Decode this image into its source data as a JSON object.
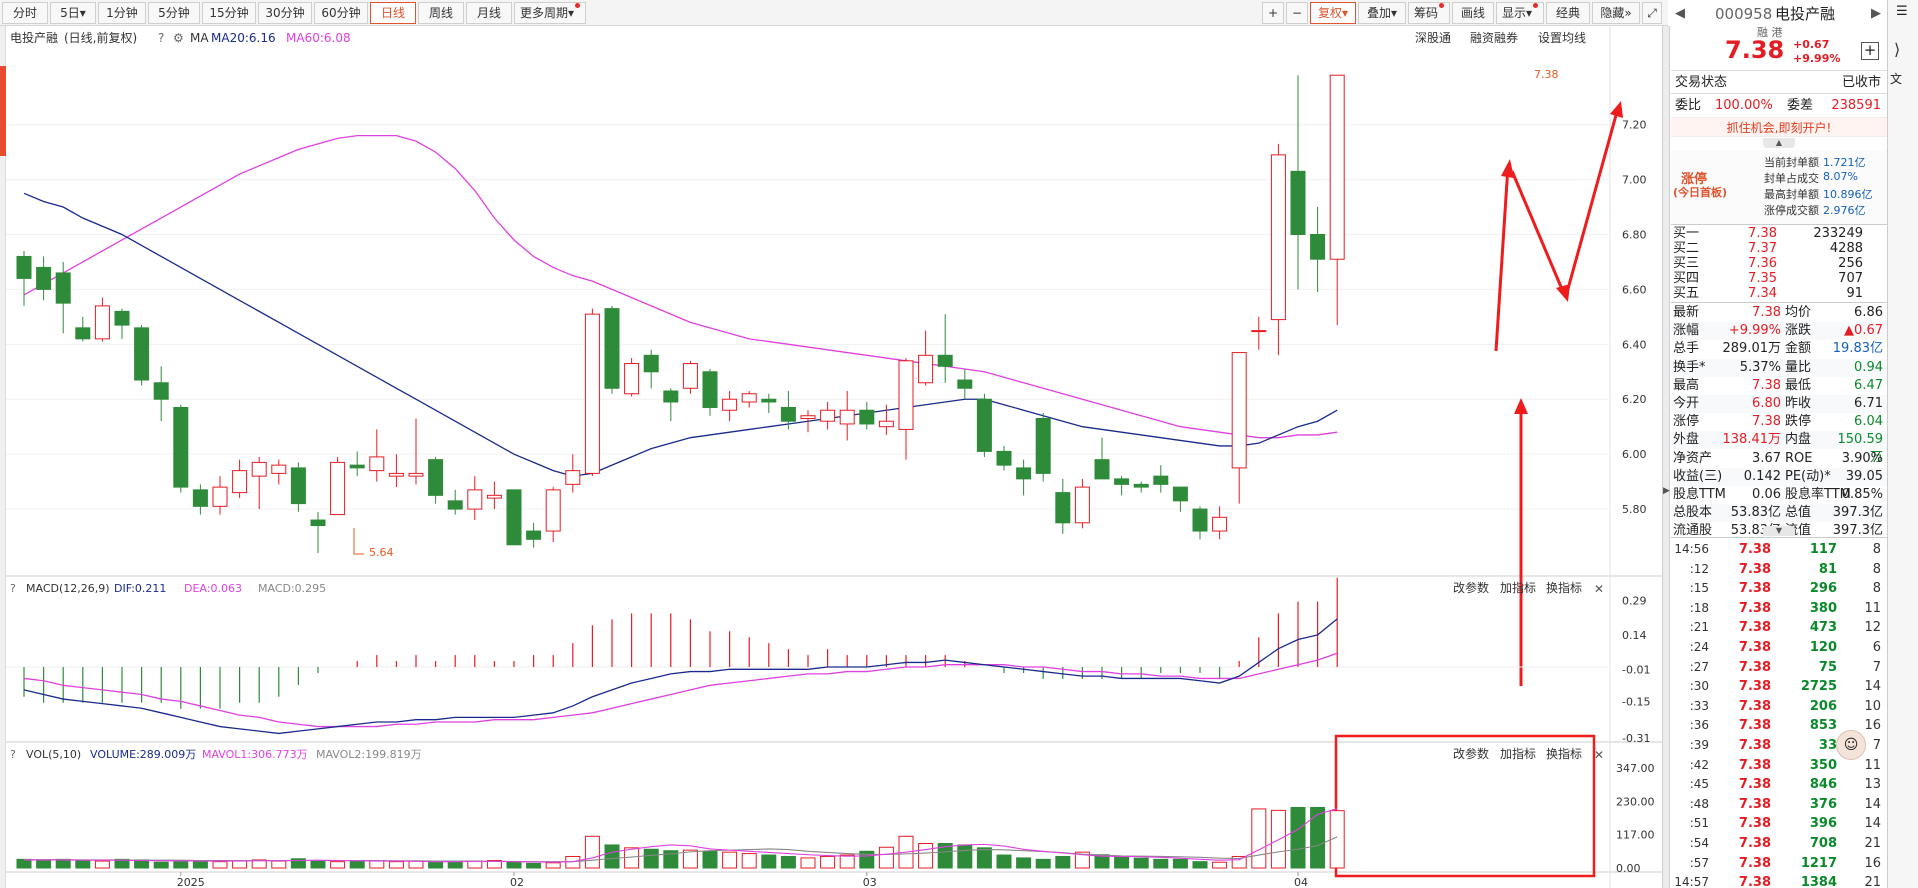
{
  "toolbar": {
    "periods": [
      "分时",
      "5日",
      "1分钟",
      "5分钟",
      "15分钟",
      "30分钟",
      "60分钟",
      "日线",
      "周线",
      "月线",
      "更多周期"
    ],
    "active": "日线",
    "right": [
      "+",
      "−",
      "复权",
      "叠加",
      "筹码",
      "画线",
      "显示",
      "经典",
      "隐藏"
    ]
  },
  "main": {
    "stock_label": "电投产融",
    "subtitle": "(日线,前复权)",
    "ma_label": "MA",
    "ma20": "MA20:6.16",
    "ma60": "MA60:6.08",
    "right_links": [
      "深股通",
      "融资融券",
      "设置均线"
    ],
    "high_note": "7.38",
    "low_note": "5.64"
  },
  "macd_panel": {
    "label": "MACD(12,26,9)",
    "dif": "DIF:0.211",
    "dea": "DEA:0.063",
    "macd": "MACD:0.295",
    "buttons": [
      "改参数",
      "加指标",
      "换指标"
    ],
    "close": "✕"
  },
  "vol_panel": {
    "label": "VOL(5,10)",
    "volume": "VOLUME:289.009万",
    "mavol1": "MAVOL1:306.773万",
    "mavol2": "MAVOL2:199.819万",
    "buttons": [
      "改参数",
      "加指标",
      "换指标"
    ],
    "close": "✕"
  },
  "axis": {
    "price_ticks": [
      "7.20",
      "7.00",
      "6.80",
      "6.60",
      "6.40",
      "6.20",
      "6.00",
      "5.80"
    ],
    "macd_ticks": [
      "0.29",
      "0.14",
      "-0.01",
      "-0.15",
      "-0.31"
    ],
    "vol_ticks": [
      "347.00",
      "230.00",
      "117.00",
      "0.00"
    ],
    "date_labels": [
      "2025",
      "02",
      "03",
      "04"
    ]
  },
  "colors": {
    "up": "#e51c23",
    "down": "#2e8b3a",
    "ma20": "#1a2a8c",
    "ma60": "#e040e0",
    "dea": "#e040e0",
    "dif": "#1a2a8c",
    "mavol1": "#e040e0",
    "mavol2": "#888888",
    "annot": "#ee1c1c"
  },
  "chart_data": {
    "type": "candlestick",
    "ylim": [
      5.6,
      7.45
    ],
    "candles": [
      [
        6.72,
        6.64,
        6.74,
        6.54
      ],
      [
        6.68,
        6.6,
        6.72,
        6.56
      ],
      [
        6.66,
        6.55,
        6.7,
        6.44
      ],
      [
        6.46,
        6.42,
        6.5,
        6.41
      ],
      [
        6.42,
        6.54,
        6.57,
        6.41
      ],
      [
        6.52,
        6.47,
        6.53,
        6.42
      ],
      [
        6.46,
        6.27,
        6.47,
        6.25
      ],
      [
        6.26,
        6.2,
        6.32,
        6.12
      ],
      [
        6.17,
        5.88,
        6.18,
        5.86
      ],
      [
        5.87,
        5.81,
        5.89,
        5.78
      ],
      [
        5.81,
        5.88,
        5.92,
        5.78
      ],
      [
        5.86,
        5.94,
        5.98,
        5.84
      ],
      [
        5.92,
        5.97,
        5.99,
        5.8
      ],
      [
        5.93,
        5.96,
        5.98,
        5.89
      ],
      [
        5.95,
        5.82,
        5.97,
        5.79
      ],
      [
        5.76,
        5.74,
        5.79,
        5.64
      ],
      [
        5.78,
        5.97,
        5.99,
        5.78
      ],
      [
        5.96,
        5.95,
        6.01,
        5.92
      ],
      [
        5.94,
        5.99,
        6.09,
        5.9
      ],
      [
        5.92,
        5.93,
        6.0,
        5.88
      ],
      [
        5.92,
        5.93,
        6.13,
        5.89
      ],
      [
        5.98,
        5.85,
        5.99,
        5.82
      ],
      [
        5.83,
        5.8,
        5.87,
        5.78
      ],
      [
        5.8,
        5.87,
        5.92,
        5.76
      ],
      [
        5.84,
        5.85,
        5.9,
        5.8
      ],
      [
        5.87,
        5.67,
        5.87,
        5.67
      ],
      [
        5.72,
        5.69,
        5.75,
        5.66
      ],
      [
        5.72,
        5.87,
        5.88,
        5.68
      ],
      [
        5.89,
        5.94,
        6.0,
        5.86
      ],
      [
        5.93,
        6.51,
        6.53,
        5.92
      ],
      [
        6.53,
        6.24,
        6.54,
        6.22
      ],
      [
        6.22,
        6.33,
        6.35,
        6.21
      ],
      [
        6.36,
        6.3,
        6.38,
        6.24
      ],
      [
        6.23,
        6.19,
        6.24,
        6.12
      ],
      [
        6.24,
        6.33,
        6.34,
        6.22
      ],
      [
        6.3,
        6.17,
        6.31,
        6.14
      ],
      [
        6.16,
        6.2,
        6.23,
        6.12
      ],
      [
        6.19,
        6.22,
        6.23,
        6.17
      ],
      [
        6.2,
        6.19,
        6.22,
        6.15
      ],
      [
        6.17,
        6.12,
        6.23,
        6.09
      ],
      [
        6.13,
        6.14,
        6.16,
        6.08
      ],
      [
        6.12,
        6.16,
        6.19,
        6.09
      ],
      [
        6.11,
        6.16,
        6.23,
        6.05
      ],
      [
        6.16,
        6.11,
        6.19,
        6.09
      ],
      [
        6.1,
        6.12,
        6.18,
        6.07
      ],
      [
        6.09,
        6.34,
        6.35,
        5.98
      ],
      [
        6.26,
        6.36,
        6.45,
        6.25
      ],
      [
        6.36,
        6.32,
        6.51,
        6.26
      ],
      [
        6.27,
        6.24,
        6.31,
        6.2
      ],
      [
        6.2,
        6.01,
        6.22,
        5.99
      ],
      [
        6.01,
        5.96,
        6.03,
        5.94
      ],
      [
        5.95,
        5.91,
        5.98,
        5.85
      ],
      [
        6.13,
        5.93,
        6.15,
        5.9
      ],
      [
        5.86,
        5.75,
        5.91,
        5.71
      ],
      [
        5.75,
        5.88,
        5.91,
        5.73
      ],
      [
        5.98,
        5.91,
        6.06,
        5.91
      ],
      [
        5.91,
        5.89,
        5.92,
        5.85
      ],
      [
        5.89,
        5.88,
        5.9,
        5.86
      ],
      [
        5.92,
        5.89,
        5.96,
        5.86
      ],
      [
        5.88,
        5.83,
        5.88,
        5.79
      ],
      [
        5.8,
        5.72,
        5.81,
        5.69
      ],
      [
        5.72,
        5.77,
        5.81,
        5.69
      ],
      [
        5.95,
        6.37,
        6.37,
        5.82
      ],
      [
        6.45,
        6.45,
        6.5,
        6.38
      ],
      [
        6.49,
        7.09,
        7.13,
        6.36
      ],
      [
        7.03,
        6.8,
        7.38,
        6.6
      ],
      [
        6.8,
        6.71,
        6.9,
        6.59
      ],
      [
        6.71,
        7.38,
        7.38,
        6.47
      ]
    ],
    "ma20": [
      6.95,
      6.92,
      6.9,
      6.86,
      6.83,
      6.8,
      6.76,
      6.72,
      6.68,
      6.64,
      6.6,
      6.56,
      6.52,
      6.48,
      6.44,
      6.4,
      6.36,
      6.32,
      6.28,
      6.24,
      6.2,
      6.16,
      6.12,
      6.08,
      6.04,
      6.0,
      5.97,
      5.94,
      5.92,
      5.93,
      5.96,
      5.99,
      6.02,
      6.04,
      6.06,
      6.07,
      6.08,
      6.09,
      6.1,
      6.11,
      6.12,
      6.13,
      6.14,
      6.15,
      6.16,
      6.17,
      6.18,
      6.19,
      6.2,
      6.2,
      6.18,
      6.16,
      6.14,
      6.12,
      6.1,
      6.09,
      6.08,
      6.07,
      6.06,
      6.05,
      6.04,
      6.03,
      6.03,
      6.04,
      6.07,
      6.1,
      6.12,
      6.16
    ],
    "ma60": [
      6.58,
      6.62,
      6.66,
      6.7,
      6.74,
      6.78,
      6.82,
      6.86,
      6.9,
      6.94,
      6.98,
      7.02,
      7.05,
      7.08,
      7.11,
      7.13,
      7.15,
      7.16,
      7.16,
      7.16,
      7.14,
      7.1,
      7.04,
      6.96,
      6.86,
      6.78,
      6.72,
      6.68,
      6.65,
      6.63,
      6.6,
      6.57,
      6.54,
      6.51,
      6.48,
      6.46,
      6.44,
      6.42,
      6.41,
      6.4,
      6.39,
      6.38,
      6.37,
      6.36,
      6.35,
      6.34,
      6.33,
      6.32,
      6.31,
      6.3,
      6.28,
      6.26,
      6.24,
      6.22,
      6.2,
      6.18,
      6.16,
      6.14,
      6.12,
      6.1,
      6.09,
      6.08,
      6.07,
      6.06,
      6.06,
      6.07,
      6.07,
      6.08
    ],
    "macd_ylim": [
      -0.31,
      0.31
    ],
    "dif": [
      -0.1,
      -0.12,
      -0.14,
      -0.15,
      -0.16,
      -0.17,
      -0.18,
      -0.2,
      -0.22,
      -0.24,
      -0.26,
      -0.27,
      -0.28,
      -0.29,
      -0.28,
      -0.27,
      -0.26,
      -0.25,
      -0.24,
      -0.24,
      -0.23,
      -0.23,
      -0.22,
      -0.22,
      -0.22,
      -0.22,
      -0.21,
      -0.2,
      -0.17,
      -0.13,
      -0.1,
      -0.07,
      -0.05,
      -0.03,
      -0.02,
      -0.02,
      -0.01,
      -0.01,
      -0.01,
      -0.01,
      -0.01,
      0.0,
      0.0,
      0.0,
      0.01,
      0.02,
      0.02,
      0.03,
      0.02,
      0.01,
      0.0,
      -0.01,
      -0.02,
      -0.03,
      -0.04,
      -0.04,
      -0.05,
      -0.05,
      -0.05,
      -0.05,
      -0.06,
      -0.07,
      -0.04,
      0.02,
      0.08,
      0.12,
      0.14,
      0.21
    ],
    "dea": [
      -0.05,
      -0.06,
      -0.08,
      -0.09,
      -0.1,
      -0.11,
      -0.12,
      -0.14,
      -0.15,
      -0.17,
      -0.19,
      -0.21,
      -0.22,
      -0.24,
      -0.25,
      -0.26,
      -0.26,
      -0.26,
      -0.26,
      -0.25,
      -0.25,
      -0.24,
      -0.24,
      -0.24,
      -0.23,
      -0.23,
      -0.23,
      -0.22,
      -0.21,
      -0.2,
      -0.18,
      -0.16,
      -0.14,
      -0.12,
      -0.1,
      -0.08,
      -0.07,
      -0.06,
      -0.05,
      -0.04,
      -0.03,
      -0.03,
      -0.02,
      -0.02,
      -0.01,
      0.0,
      0.0,
      0.01,
      0.01,
      0.01,
      0.01,
      0.0,
      0.0,
      -0.01,
      -0.02,
      -0.02,
      -0.03,
      -0.03,
      -0.04,
      -0.04,
      -0.05,
      -0.05,
      -0.05,
      -0.03,
      -0.01,
      0.01,
      0.03,
      0.06
    ],
    "vol_ylim": [
      0,
      347
    ],
    "vol": [
      30,
      28,
      30,
      26,
      24,
      30,
      28,
      20,
      22,
      25,
      22,
      26,
      28,
      24,
      32,
      26,
      22,
      24,
      25,
      22,
      24,
      20,
      22,
      24,
      26,
      20,
      16,
      18,
      40,
      110,
      80,
      70,
      65,
      60,
      62,
      58,
      55,
      50,
      45,
      40,
      35,
      40,
      45,
      58,
      72,
      110,
      85,
      85,
      80,
      70,
      45,
      35,
      30,
      40,
      55,
      46,
      40,
      34,
      30,
      30,
      22,
      20,
      40,
      205,
      200,
      210,
      210,
      199
    ],
    "mavol1": [
      28,
      28,
      28,
      27,
      27,
      27,
      26,
      25,
      25,
      24,
      24,
      24,
      25,
      25,
      26,
      27,
      26,
      25,
      24,
      24,
      23,
      22,
      22,
      23,
      23,
      22,
      21,
      20,
      22,
      35,
      55,
      65,
      74,
      80,
      77,
      66,
      62,
      58,
      54,
      50,
      46,
      43,
      41,
      42,
      48,
      55,
      64,
      74,
      80,
      82,
      76,
      65,
      58,
      52,
      46,
      41,
      40,
      39,
      37,
      34,
      30,
      27,
      29,
      63,
      98,
      134,
      186,
      206
    ],
    "mavol2": [
      29,
      29,
      29,
      28,
      28,
      28,
      27,
      27,
      27,
      26,
      26,
      26,
      26,
      26,
      26,
      26,
      26,
      26,
      26,
      25,
      25,
      24,
      24,
      24,
      23,
      23,
      22,
      22,
      22,
      27,
      33,
      38,
      44,
      49,
      56,
      60,
      62,
      64,
      66,
      64,
      58,
      54,
      50,
      47,
      47,
      49,
      52,
      56,
      61,
      64,
      63,
      60,
      57,
      53,
      48,
      45,
      42,
      41,
      40,
      39,
      37,
      34,
      33,
      45,
      56,
      65,
      78,
      108
    ]
  },
  "quote": {
    "code": "000958",
    "name": "电投产融",
    "tags": "融 港",
    "price": "7.38",
    "change": "+0.67",
    "pct": "+9.99%",
    "trade_status_label": "交易状态",
    "trade_status": "已收市",
    "weibi_label": "委比",
    "weibi": "100.00%",
    "weicha_label": "委差",
    "weicha": "238591",
    "promo": "抓住机会,即刻开户!",
    "zt_title": "涨停",
    "zt_sub": "(今日首板)",
    "zt_rows": [
      [
        "当前封单额",
        "1.721亿"
      ],
      [
        "封单占成交",
        "8.07%"
      ],
      [
        "最高封单额",
        "10.896亿"
      ],
      [
        "涨停成交额",
        "2.976亿"
      ]
    ],
    "bids": [
      [
        "买一",
        "7.38",
        "233249"
      ],
      [
        "买二",
        "7.37",
        "4288"
      ],
      [
        "买三",
        "7.36",
        "256"
      ],
      [
        "买四",
        "7.35",
        "707"
      ],
      [
        "买五",
        "7.34",
        "91"
      ]
    ],
    "stats": [
      [
        "最新",
        "7.38",
        "均价",
        "6.86"
      ],
      [
        "涨幅",
        "+9.99%",
        "涨跌",
        "▲0.67"
      ],
      [
        "总手",
        "289.01万",
        "金额",
        "19.83亿"
      ],
      [
        "换手*",
        "5.37%",
        "量比",
        "0.94"
      ],
      [
        "最高",
        "7.38",
        "最低",
        "6.47"
      ],
      [
        "今开",
        "6.80",
        "昨收",
        "6.71"
      ],
      [
        "涨停",
        "7.38",
        "跌停",
        "6.04"
      ],
      [
        "外盘",
        "138.41万",
        "内盘",
        "150.59万"
      ],
      [
        "净资产",
        "3.67",
        "ROE",
        "3.90%"
      ],
      [
        "收益(三)",
        "0.142",
        "PE(动)*",
        "39.05"
      ],
      [
        "股息TTM",
        "0.06",
        "股息率TTM",
        "0.85%"
      ],
      [
        "总股本",
        "53.83亿",
        "总值",
        "397.3亿"
      ],
      [
        "流通股",
        "53.83亿",
        "流值",
        "397.3亿"
      ]
    ],
    "ticks": [
      [
        "14:56",
        "7.38",
        "117",
        "8"
      ],
      [
        ":12",
        "7.38",
        "81",
        "8"
      ],
      [
        ":15",
        "7.38",
        "296",
        "8"
      ],
      [
        ":18",
        "7.38",
        "380",
        "11"
      ],
      [
        ":21",
        "7.38",
        "473",
        "12"
      ],
      [
        ":24",
        "7.38",
        "120",
        "6"
      ],
      [
        ":27",
        "7.38",
        "75",
        "7"
      ],
      [
        ":30",
        "7.38",
        "2725",
        "14"
      ],
      [
        ":33",
        "7.38",
        "206",
        "10"
      ],
      [
        ":36",
        "7.38",
        "853",
        "16"
      ],
      [
        ":39",
        "7.38",
        "33",
        "7"
      ],
      [
        ":42",
        "7.38",
        "350",
        "11"
      ],
      [
        ":45",
        "7.38",
        "846",
        "13"
      ],
      [
        ":48",
        "7.38",
        "376",
        "14"
      ],
      [
        ":51",
        "7.38",
        "396",
        "14"
      ],
      [
        ":54",
        "7.38",
        "708",
        "21"
      ],
      [
        ":57",
        "7.38",
        "1217",
        "16"
      ],
      [
        "14:57",
        "7.38",
        "1384",
        "21"
      ]
    ]
  },
  "far_right": {
    "label": "文"
  }
}
